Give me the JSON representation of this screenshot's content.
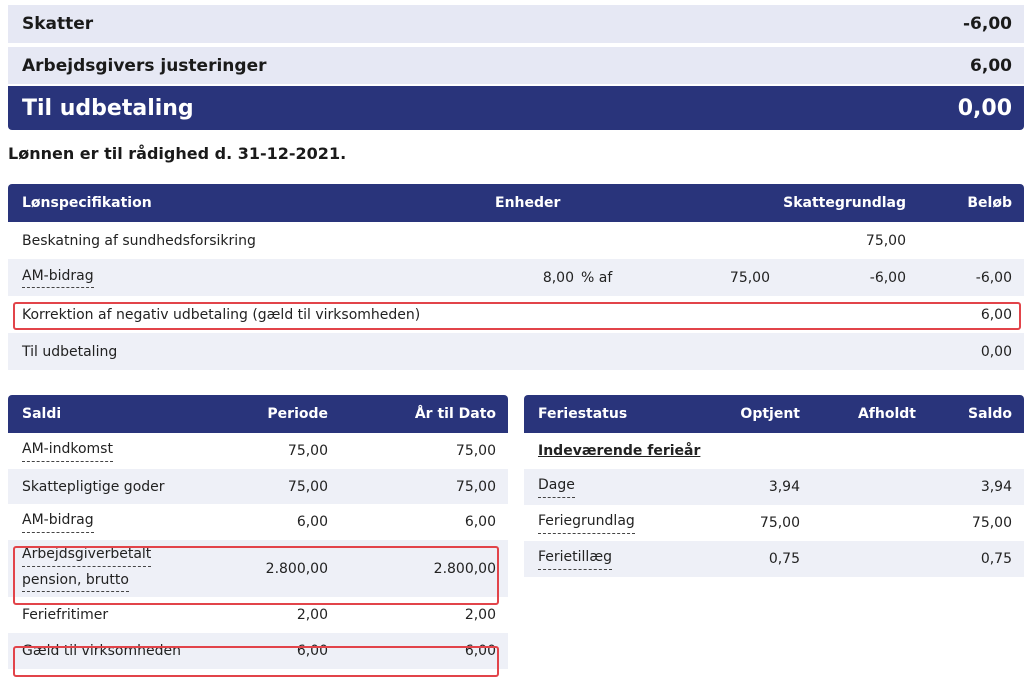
{
  "summary": {
    "skatter": {
      "label": "Skatter",
      "value": "-6,00"
    },
    "justeringer": {
      "label": "Arbejdsgivers justeringer",
      "value": "6,00"
    },
    "udbetaling": {
      "label": "Til udbetaling",
      "value": "0,00"
    }
  },
  "note": "Lønnen er til rådighed d. 31-12-2021.",
  "lonspec": {
    "headers": {
      "name": "Lønspecifikation",
      "enheder": "Enheder",
      "skattegrundlag": "Skattegrundlag",
      "belob": "Beløb"
    },
    "rows": [
      {
        "name": "Beskatning af sundhedsforsikring",
        "enheder": "",
        "pct": "",
        "base": "",
        "skattegrundlag": "75,00",
        "belob": ""
      },
      {
        "name": "AM-bidrag",
        "enheder": "8,00",
        "pct": "% af",
        "base": "75,00",
        "skattegrundlag": "-6,00",
        "belob": "-6,00"
      },
      {
        "name": "Korrektion af negativ udbetaling (gæld til virksomheden)",
        "enheder": "",
        "pct": "",
        "base": "",
        "skattegrundlag": "",
        "belob": "6,00"
      },
      {
        "name": "Til udbetaling",
        "enheder": "",
        "pct": "",
        "base": "",
        "skattegrundlag": "",
        "belob": "0,00"
      }
    ]
  },
  "saldi": {
    "headers": {
      "name": "Saldi",
      "periode": "Periode",
      "aar": "År til Dato"
    },
    "rows": [
      {
        "name": "AM-indkomst",
        "periode": "75,00",
        "aar": "75,00"
      },
      {
        "name": "Skattepligtige goder",
        "periode": "75,00",
        "aar": "75,00"
      },
      {
        "name": "AM-bidrag",
        "periode": "6,00",
        "aar": "6,00"
      },
      {
        "name_line1": "Arbejdsgiverbetalt",
        "name_line2": "pension, brutto",
        "periode": "2.800,00",
        "aar": "2.800,00"
      },
      {
        "name": "Feriefritimer",
        "periode": "2,00",
        "aar": "2,00"
      },
      {
        "name": "Gæld til virksomheden",
        "periode": "6,00",
        "aar": "6,00"
      }
    ]
  },
  "feriestatus": {
    "headers": {
      "name": "Feriestatus",
      "optjent": "Optjent",
      "afholdt": "Afholdt",
      "saldo": "Saldo"
    },
    "section": "Indeværende ferieår",
    "rows": [
      {
        "name": "Dage",
        "optjent": "3,94",
        "afholdt": "",
        "saldo": "3,94"
      },
      {
        "name": "Feriegrundlag",
        "optjent": "75,00",
        "afholdt": "",
        "saldo": "75,00"
      },
      {
        "name": "Ferietillæg",
        "optjent": "0,75",
        "afholdt": "",
        "saldo": "0,75"
      }
    ]
  }
}
